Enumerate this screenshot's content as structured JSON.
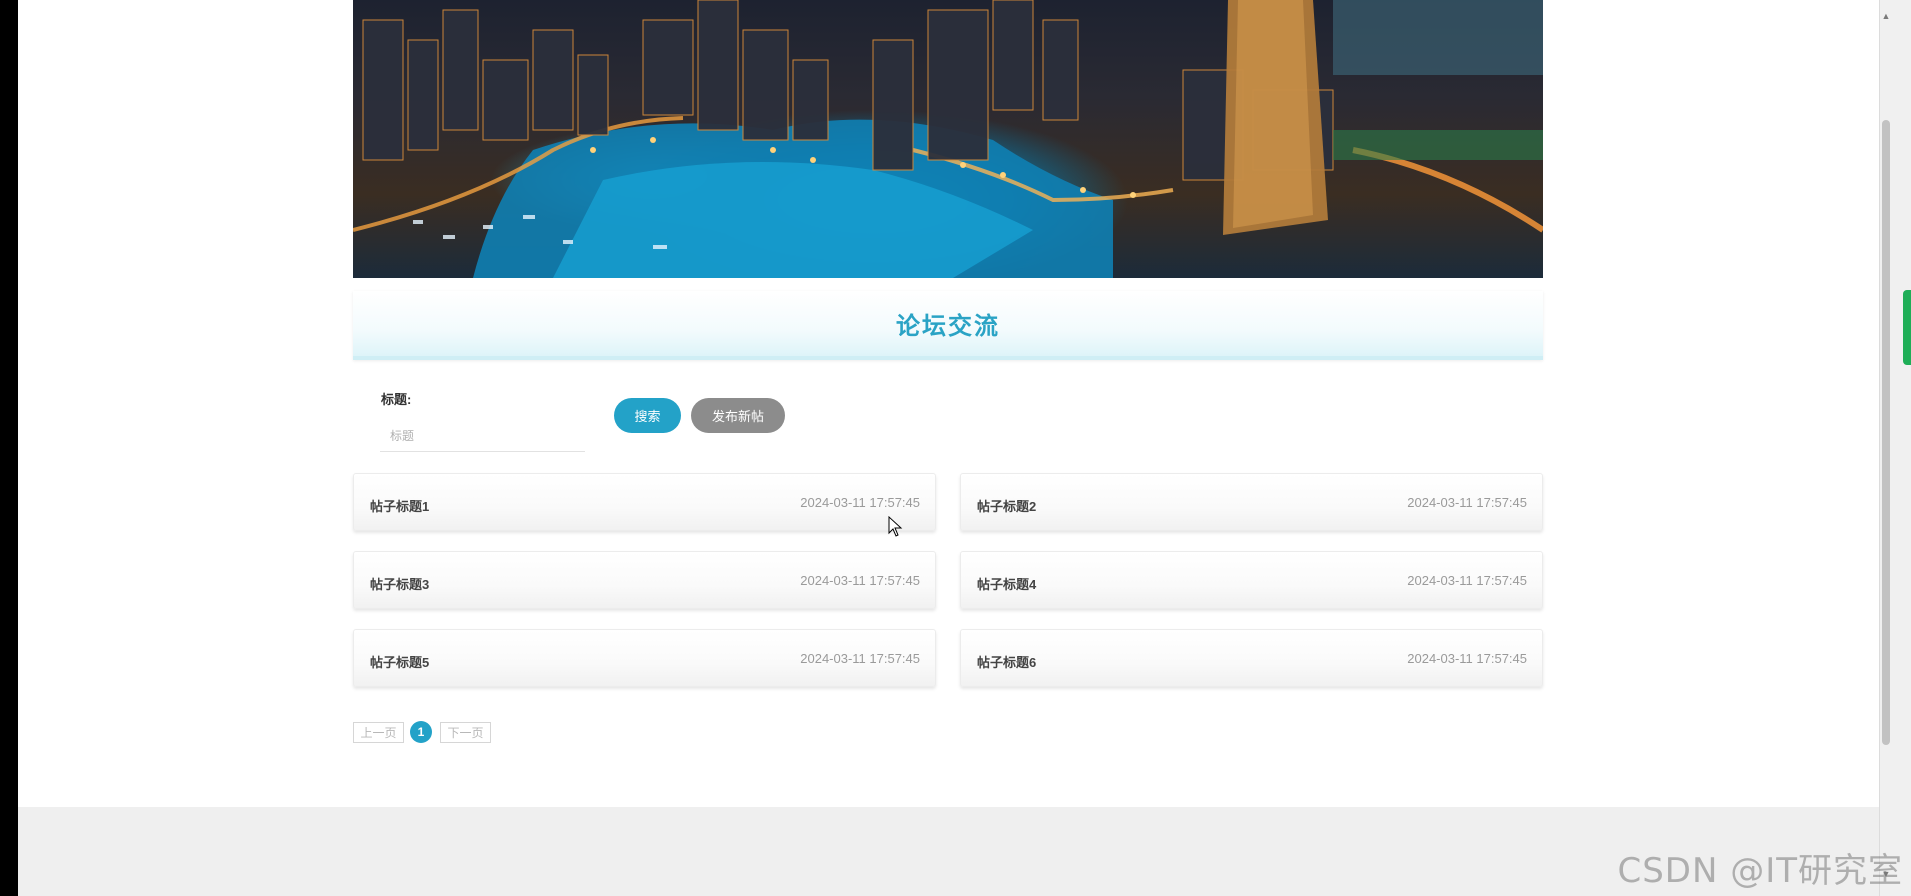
{
  "section_title": "论坛交流",
  "search": {
    "label": "标题:",
    "placeholder": "标题",
    "value": "",
    "search_button": "搜索",
    "new_post_button": "发布新帖"
  },
  "posts": [
    {
      "title": "帖子标题1",
      "date": "2024-03-11 17:57:45"
    },
    {
      "title": "帖子标题2",
      "date": "2024-03-11 17:57:45"
    },
    {
      "title": "帖子标题3",
      "date": "2024-03-11 17:57:45"
    },
    {
      "title": "帖子标题4",
      "date": "2024-03-11 17:57:45"
    },
    {
      "title": "帖子标题5",
      "date": "2024-03-11 17:57:45"
    },
    {
      "title": "帖子标题6",
      "date": "2024-03-11 17:57:45"
    }
  ],
  "pagination": {
    "prev": "上一页",
    "current": "1",
    "next": "下一页"
  },
  "watermark": "CSDN @IT研究室",
  "colors": {
    "accent": "#23a2c8",
    "title": "#2aa3c5",
    "secondary_button": "#8c8c8c"
  }
}
